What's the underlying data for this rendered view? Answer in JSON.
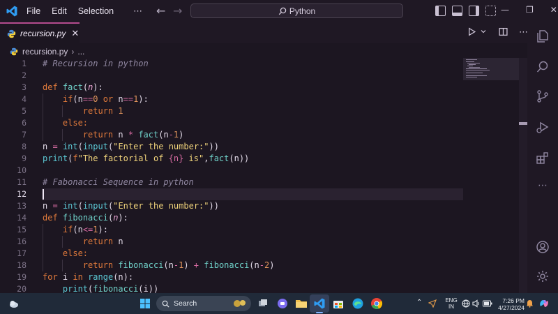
{
  "titlebar": {
    "menu": [
      "File",
      "Edit",
      "Selection"
    ],
    "more": "⋯",
    "search_text": "Python"
  },
  "tab": {
    "label": "recursion.py",
    "close": "✕"
  },
  "breadcrumb": {
    "file": "recursion.py",
    "more": "..."
  },
  "editor": {
    "current_line": 12,
    "lines": [
      {
        "n": "1"
      },
      {
        "n": "2"
      },
      {
        "n": "3"
      },
      {
        "n": "4"
      },
      {
        "n": "5"
      },
      {
        "n": "6"
      },
      {
        "n": "7"
      },
      {
        "n": "8"
      },
      {
        "n": "9"
      },
      {
        "n": "10"
      },
      {
        "n": "11"
      },
      {
        "n": "12"
      },
      {
        "n": "13"
      },
      {
        "n": "14"
      },
      {
        "n": "15"
      },
      {
        "n": "16"
      },
      {
        "n": "17"
      },
      {
        "n": "18"
      },
      {
        "n": "19"
      },
      {
        "n": "20"
      }
    ],
    "code": {
      "l1": "# Recursion in python",
      "l3_kw": "def",
      "l3_fn": "fact",
      "l3_p": "n",
      "l4_kw": "if",
      "l4_a": "(n",
      "l4_op1": "==",
      "l4_n1": "0",
      "l4_or": "or",
      "l4_b": "n",
      "l4_op2": "==",
      "l4_n2": "1",
      "l4_c": "):",
      "l5_kw": "return",
      "l5_n": "1",
      "l6_kw": "else:",
      "l7_kw": "return",
      "l7_a": "n",
      "l7_op": "*",
      "l7_fn": "fact",
      "l7_b": "(n",
      "l7_op2": "-",
      "l7_n": "1",
      "l7_c": ")",
      "l8_a": "n",
      "l8_op": "=",
      "l8_int": "int",
      "l8_inp": "input",
      "l8_str": "\"Enter the number:\"",
      "l9_print": "print",
      "l9_f": "f",
      "l9_str1": "\"The factorial of ",
      "l9_var": "{n}",
      "l9_str2": " is\"",
      "l9_fn": "fact",
      "l11": "# Fabonacci Sequence in python",
      "l13_a": "n",
      "l13_op": "=",
      "l13_int": "int",
      "l13_inp": "input",
      "l13_str": "\"Enter the number:\"",
      "l14_kw": "def",
      "l14_fn": "fibonacci",
      "l14_p": "n",
      "l15_kw": "if",
      "l15_a": "(n",
      "l15_op": "<=",
      "l15_n": "1",
      "l15_c": "):",
      "l16_kw": "return",
      "l16_a": "n",
      "l17_kw": "else:",
      "l18_kw": "return",
      "l18_fn1": "fibonacci",
      "l18_a": "(n",
      "l18_op1": "-",
      "l18_n1": "1",
      "l18_op2": "+",
      "l18_fn2": "fibonacci",
      "l18_b": "(n",
      "l18_op3": "-",
      "l18_n2": "2",
      "l19_kw": "for",
      "l19_a": "i",
      "l19_in": "in",
      "l19_range": "range",
      "l19_b": "(n):",
      "l20_print": "print",
      "l20_fn": "fibonacci",
      "l20_a": "(i))"
    }
  },
  "taskbar": {
    "search_label": "Search",
    "lang_line1": "ENG",
    "lang_line2": "IN",
    "time": "7:26 PM",
    "date": "4/27/2024"
  },
  "colors": {
    "accent": "#b44b8e",
    "editor_bg": "#1c1621",
    "keyword": "#e07a3c",
    "function": "#6fd0c8",
    "string": "#eed27a",
    "comment": "#8f86a0"
  }
}
